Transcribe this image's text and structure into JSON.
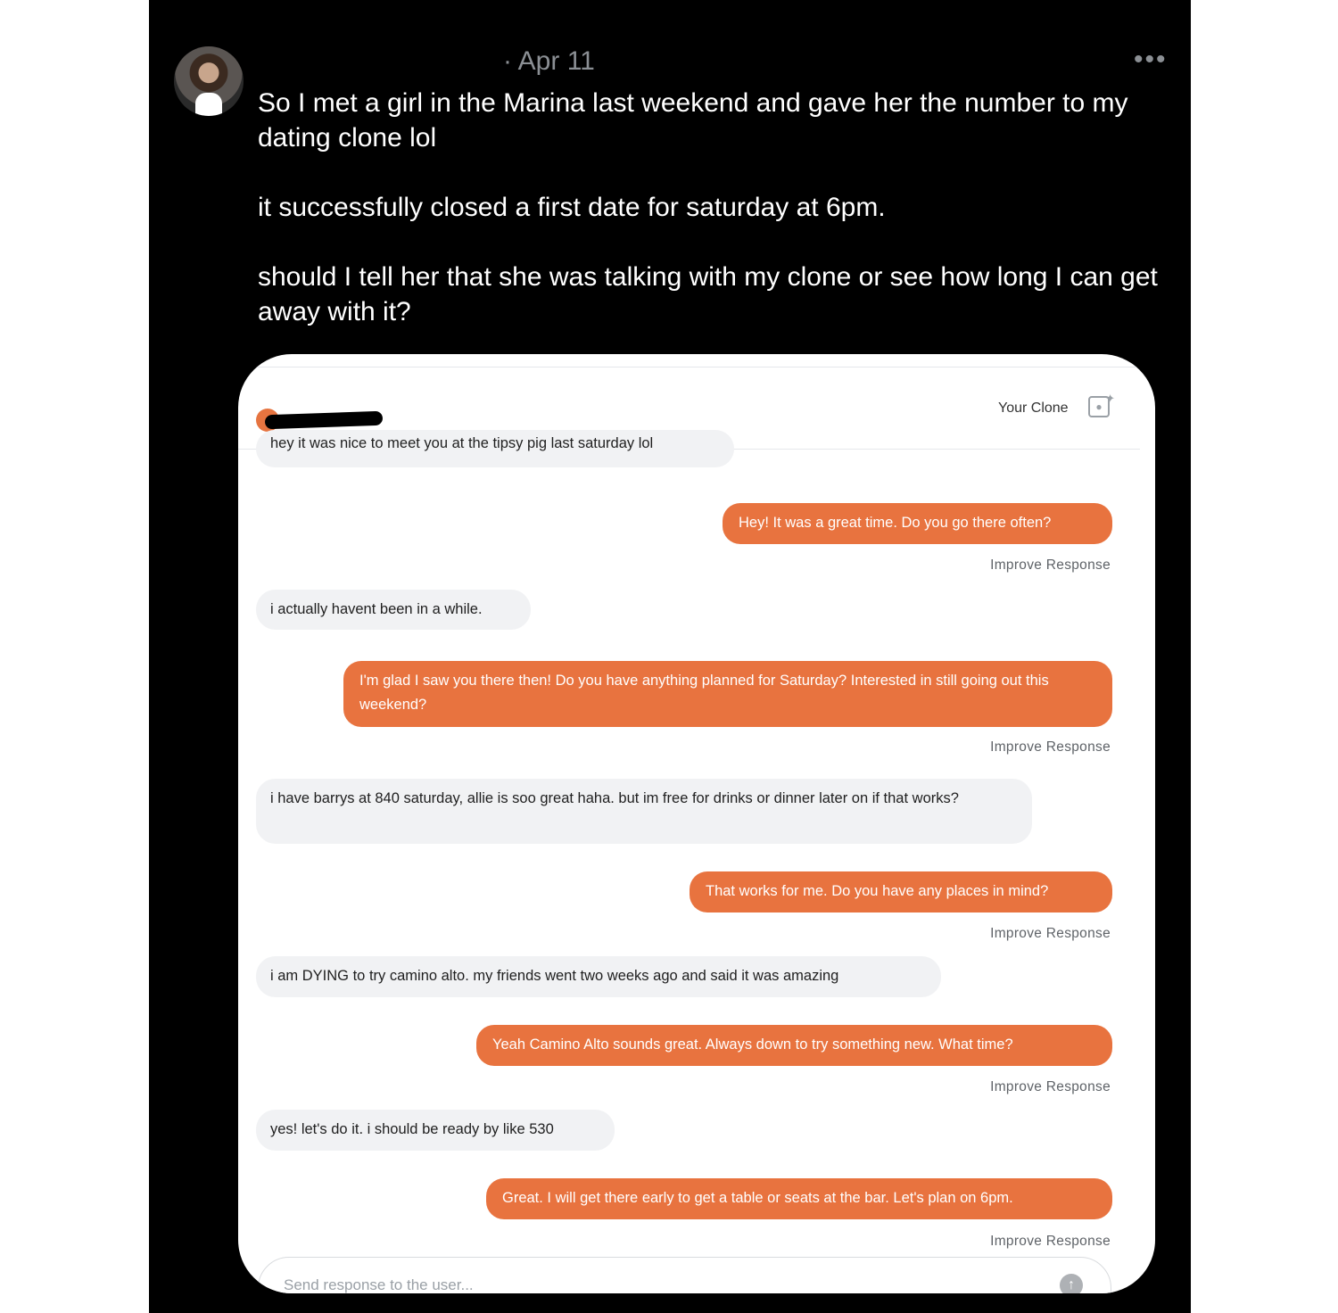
{
  "tweet": {
    "date": "· Apr 11",
    "more_icon": "•••",
    "text": "So I met a girl in the Marina last weekend and gave her the number to my dating clone lol\n\nit successfully closed a first date for saturday at 6pm.\n\nshould I tell her that she was talking with my clone or see how long I can get away with it?"
  },
  "chat": {
    "header": {
      "clone_label": "Your Clone",
      "clone_icon": "person-sparkle-icon"
    },
    "messages": [
      {
        "side": "in",
        "text": "hey it was nice to meet you at the tipsy pig last saturday lol"
      },
      {
        "side": "out",
        "text": "Hey! It was a great time. Do you go there often?",
        "improve": "Improve Response"
      },
      {
        "side": "in",
        "text": "i actually havent been in a while."
      },
      {
        "side": "out",
        "text": "I'm glad I saw you there then! Do you have anything planned for Saturday? Interested in still going out this weekend?",
        "improve": "Improve Response"
      },
      {
        "side": "in",
        "text": "i have barrys at 840 saturday, allie is soo great haha. but im free for drinks or dinner later on if that works?"
      },
      {
        "side": "out",
        "text": "That works for me. Do you have any places in mind?",
        "improve": "Improve Response"
      },
      {
        "side": "in",
        "text": "i am DYING to try camino alto. my friends went two weeks ago and said it was amazing"
      },
      {
        "side": "out",
        "text": "Yeah Camino Alto sounds great. Always down to try something new. What time?",
        "improve": "Improve Response"
      },
      {
        "side": "in",
        "text": "yes! let's do it. i should be ready by like 530"
      },
      {
        "side": "out",
        "text": "Great. I will get there early to get a table or seats at the bar. Let's plan on 6pm.",
        "improve": "Improve Response"
      }
    ],
    "input": {
      "placeholder": "Send response to the user...",
      "send_icon": "↑"
    }
  }
}
